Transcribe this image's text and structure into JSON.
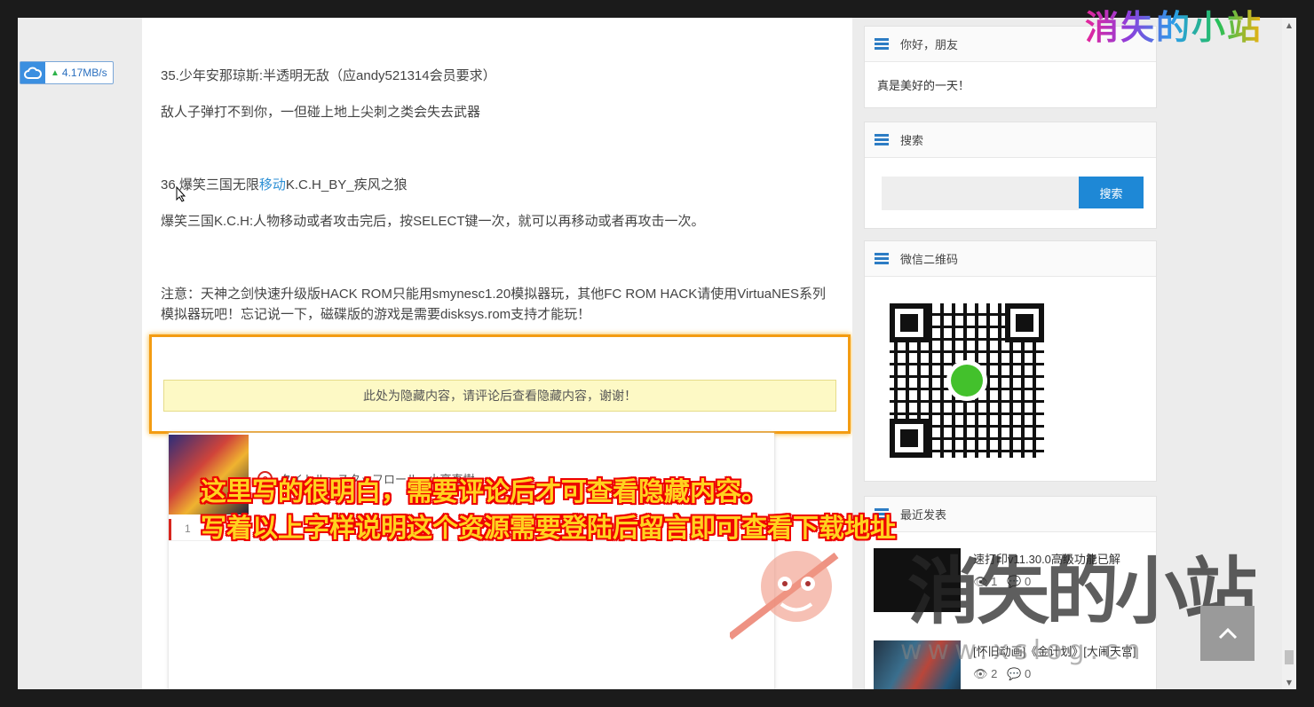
{
  "speed_indicator": {
    "value": "4.17MB/s"
  },
  "article": {
    "item35_title": "35.少年安那琼斯:半透明无敌（应andy521314会员要求）",
    "item35_desc": "敌人子弹打不到你，一但碰上地上尖刺之类会失去武器",
    "item36_prefix": "36.爆笑三国无限",
    "item36_link": "移动",
    "item36_suffix": "K.C.H_BY_疾风之狼",
    "item36_desc": "爆笑三国K.C.H:人物移动或者攻击完后，按SELECT键一次，就可以再移动或者再攻击一次。",
    "note": "注意：天神之剑快速升级版HACK ROM只能用smynesc1.20模拟器玩，其他FC ROM HACK请使用VirtuaNES系列模拟器玩吧！忘记说一下，磁碟版的游戏是需要disksys.rom支持才能玩！",
    "hidden_notice": "此处为隐藏内容，请评论后查看隐藏内容，谢谢！"
  },
  "player": {
    "song_title": "タイトル～スタッフロール - 小高直樹",
    "track_number": "1"
  },
  "annotation": {
    "line1": "这里写的很明白，需要评论后才可查看隐藏内容。",
    "line2": "写着以上字样说明这个资源需要登陆后留言即可查看下载地址"
  },
  "sidebar": {
    "greeting_widget": {
      "title": "你好，朋友",
      "text": "真是美好的一天！"
    },
    "search_widget": {
      "title": "搜索",
      "button_label": "搜索",
      "placeholder": ""
    },
    "wechat_widget": {
      "title": "微信二维码"
    },
    "recent_widget": {
      "title": "最近发表",
      "posts": [
        {
          "title": "速打印v11.30.0高级功能已解",
          "views": "1",
          "comments": "0"
        },
        {
          "title": "[怀旧动画]《金计划》[大闹天宫]",
          "views": "2",
          "comments": "0"
        }
      ]
    }
  },
  "watermark": {
    "logo_text": "消失的小站",
    "big_text": "消失的小站",
    "url_text": "www.xslog.cn"
  },
  "colors": {
    "accent": "#1e88d6",
    "highlight_border": "#f39c12",
    "annotation_text": "#ffd21f",
    "annotation_outline": "#e00000"
  }
}
